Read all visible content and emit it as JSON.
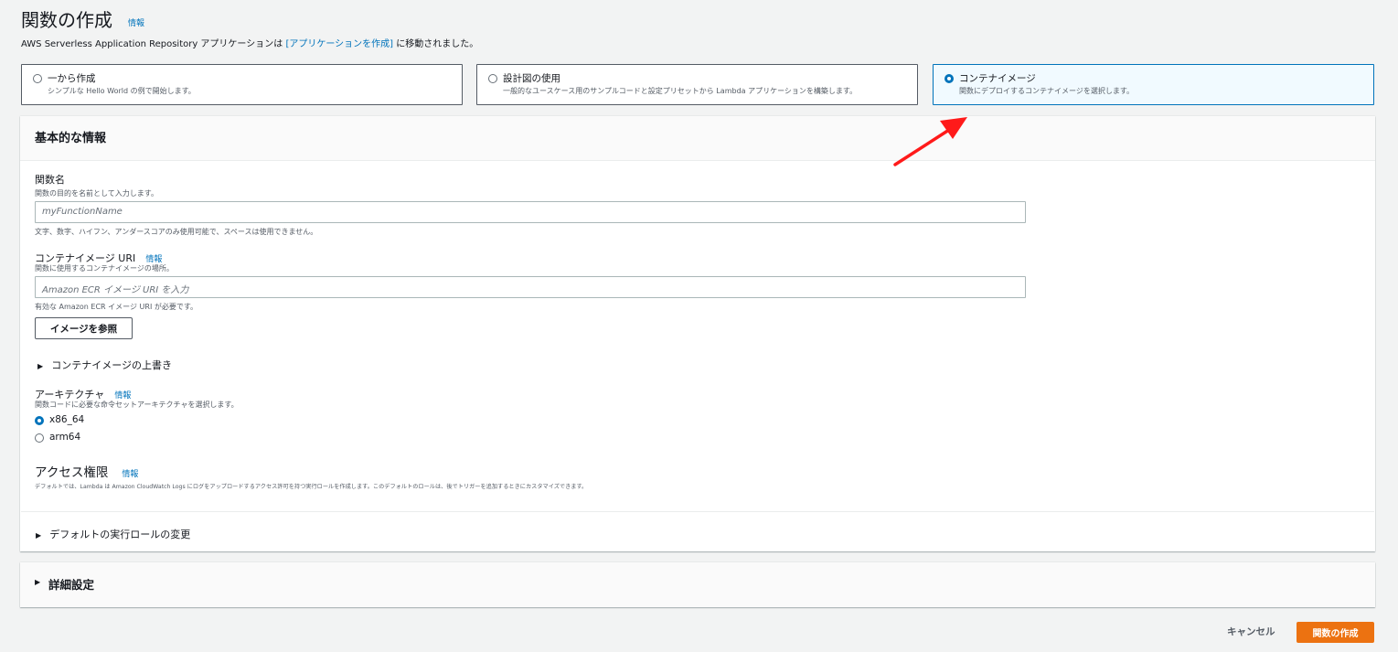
{
  "header": {
    "title": "関数の作成",
    "info_link": "情報",
    "notice_prefix": "AWS Serverless Application Repository アプリケーションは",
    "notice_link": "[アプリケーションを作成]",
    "notice_suffix": "に移動されました。"
  },
  "options": [
    {
      "label": "一から作成",
      "description": "シンプルな Hello World の例で開始します。",
      "selected": false
    },
    {
      "label": "設計図の使用",
      "description": "一般的なユースケース用のサンプルコードと設定プリセットから Lambda アプリケーションを構築します。",
      "selected": false
    },
    {
      "label": "コンテナイメージ",
      "description": "関数にデプロイするコンテナイメージを選択します。",
      "selected": true
    }
  ],
  "basic_info": {
    "title": "基本的な情報",
    "function_name": {
      "label": "関数名",
      "description": "関数の目的を名前として入力します。",
      "placeholder": "myFunctionName",
      "hint": "文字、数字、ハイフン、アンダースコアのみ使用可能で、スペースは使用できません。"
    },
    "image_uri": {
      "label": "コンテナイメージ URI",
      "info": "情報",
      "description": "関数に使用するコンテナイメージの場所。",
      "placeholder": "Amazon ECR イメージ URI を入力",
      "hint": "有効な Amazon ECR イメージ URI が必要です。",
      "browse_button": "イメージを参照"
    },
    "override_expander": "コンテナイメージの上書き",
    "architecture": {
      "label": "アーキテクチャ",
      "info": "情報",
      "description": "関数コードに必要な命令セットアーキテクチャを選択します。",
      "options": [
        "x86_64",
        "arm64"
      ],
      "selected": "x86_64"
    },
    "permissions": {
      "title": "アクセス権限",
      "info": "情報",
      "description": "デフォルトでは、Lambda は Amazon CloudWatch Logs にログをアップロードするアクセス許可を持つ実行ロールを作成します。このデフォルトのロールは、後でトリガーを追加するときにカスタマイズできます。",
      "role_expander": "デフォルトの実行ロールの変更"
    }
  },
  "advanced": {
    "title": "詳細設定"
  },
  "footer": {
    "cancel": "キャンセル",
    "create": "関数の作成"
  },
  "colors": {
    "accent": "#0073bb",
    "primary_button": "#ec7211",
    "annotation_arrow": "#ff0000"
  }
}
